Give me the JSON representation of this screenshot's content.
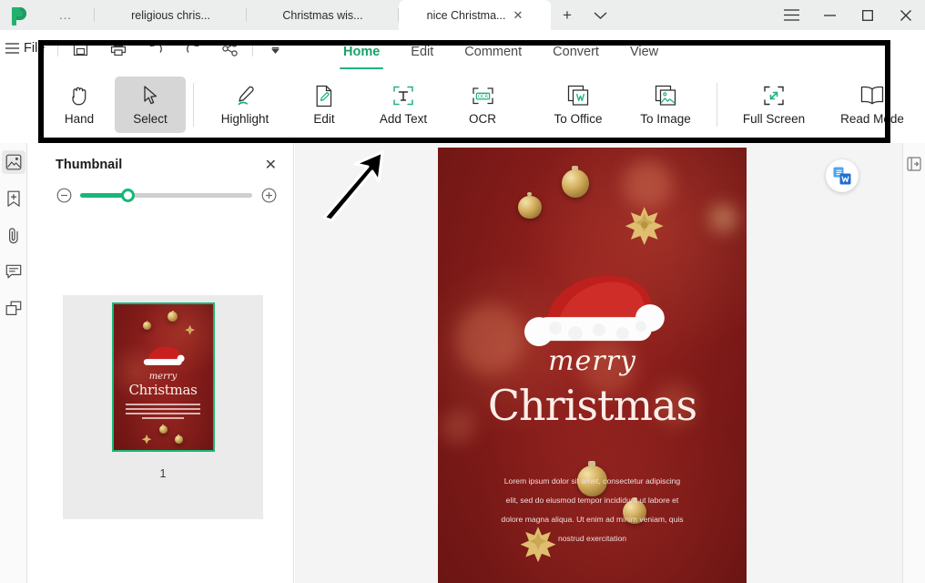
{
  "window": {
    "tabs": [
      {
        "label": "...",
        "active": false,
        "closable": false
      },
      {
        "label": "religious chris...",
        "active": false,
        "closable": false
      },
      {
        "label": "Christmas wis...",
        "active": false,
        "closable": false
      },
      {
        "label": "nice Christma...",
        "active": true,
        "closable": true
      }
    ],
    "new_tab_label": "+",
    "tab_list_label": "⌄",
    "controls": {
      "menu": "☰",
      "minimize": "–",
      "maximize": "□",
      "close": "✕"
    }
  },
  "quickbar": {
    "file_label": "File",
    "icons": [
      "hamburger-icon",
      "save-icon",
      "print-icon",
      "undo-icon",
      "redo-icon",
      "share-icon",
      "more-icon"
    ]
  },
  "ribbon_tabs": [
    {
      "label": "Home",
      "active": true
    },
    {
      "label": "Edit",
      "active": false
    },
    {
      "label": "Comment",
      "active": false
    },
    {
      "label": "Convert",
      "active": false
    },
    {
      "label": "View",
      "active": false
    }
  ],
  "tools": [
    {
      "label": "Hand",
      "icon": "hand-icon",
      "selected": false
    },
    {
      "label": "Select",
      "icon": "cursor-arrow-icon",
      "selected": true
    },
    {
      "label": "Highlight",
      "icon": "highlighter-pen-icon",
      "selected": false
    },
    {
      "label": "Edit",
      "icon": "edit-document-icon",
      "selected": false
    },
    {
      "label": "Add Text",
      "icon": "add-text-icon",
      "selected": false
    },
    {
      "label": "OCR",
      "icon": "ocr-icon",
      "selected": false
    },
    {
      "label": "To Office",
      "icon": "to-office-icon",
      "selected": false
    },
    {
      "label": "To Image",
      "icon": "to-image-icon",
      "selected": false
    },
    {
      "label": "Full Screen",
      "icon": "full-screen-icon",
      "selected": false
    },
    {
      "label": "Read Mode",
      "icon": "read-mode-book-icon",
      "selected": false
    }
  ],
  "left_rail": [
    {
      "name": "thumbnail-icon",
      "active": true
    },
    {
      "name": "bookmark-add-icon",
      "active": false
    },
    {
      "name": "attachment-icon",
      "active": false
    },
    {
      "name": "comment-icon",
      "active": false
    },
    {
      "name": "layers-icon",
      "active": false
    }
  ],
  "thumbnail_panel": {
    "title": "Thumbnail",
    "close_label": "✕",
    "zoom_out_label": "−",
    "zoom_in_label": "+",
    "zoom_value": 24,
    "page_number": "1"
  },
  "right_rail": [
    {
      "name": "collapse-panel-icon"
    }
  ],
  "float_button": {
    "name": "convert-to-word-icon",
    "letter": "W"
  },
  "annotations": {
    "rectangle": "black-highlight-rectangle",
    "arrow": "black-arrow-pointing-to-select"
  },
  "document": {
    "script_title": "merry",
    "main_title": "Christmas",
    "body_lines": [
      "Lorem ipsum dolor sit amet, consectetur adipiscing",
      "elit, sed do eiusmod tempor incididunt ut labore et",
      "dolore magna aliqua. Ut enim ad minim veniam, quis",
      "nostrud exercitation"
    ]
  },
  "colors": {
    "accent_green": "#17b877",
    "poster_red": "#8c1f1c",
    "gold": "#d6b263",
    "word_blue": "#2b7cd3",
    "selected_tool_bg": "#d6d6d6"
  }
}
